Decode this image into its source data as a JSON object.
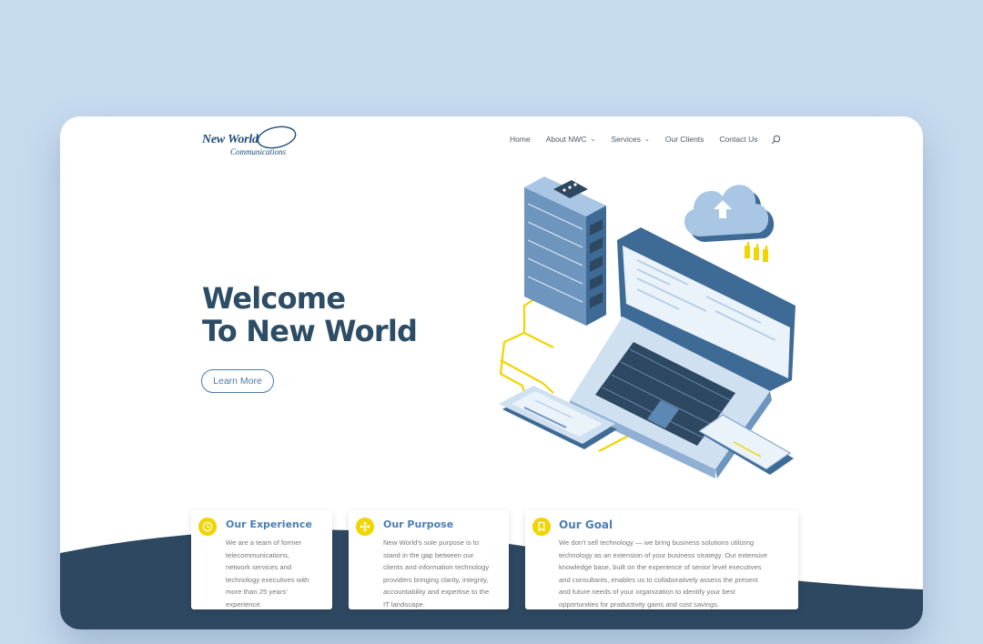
{
  "logo": {
    "line1": "New World",
    "line2": "Communications"
  },
  "nav": {
    "items": [
      {
        "label": "Home",
        "dropdown": false
      },
      {
        "label": "About NWC",
        "dropdown": true
      },
      {
        "label": "Services",
        "dropdown": true
      },
      {
        "label": "Our Clients",
        "dropdown": false
      },
      {
        "label": "Contact Us",
        "dropdown": false
      }
    ],
    "search_icon": "search-icon"
  },
  "hero": {
    "title_line1": "Welcome",
    "title_line2": "To New World",
    "cta_label": "Learn More"
  },
  "cards": [
    {
      "icon": "clock-icon",
      "title": "Our Experience",
      "lines": [
        "We are a team of former",
        "telecommunications,",
        "network services and",
        "technology executives with",
        "more than 25 years'",
        "experience."
      ]
    },
    {
      "icon": "move-arrows-icon",
      "title": "Our Purpose",
      "lines": [
        "New World's sole purpose is to",
        "stand in the gap between our",
        "clients and information technology",
        "providers bringing clarity, integrity,",
        "accountability and expertise to the",
        "IT landscape."
      ]
    },
    {
      "icon": "bookmark-icon",
      "title": "Our Goal",
      "lines": [
        "We don't sell technology — we bring business solutions utilizing",
        "technology as an extension of your business strategy. Our extensive",
        "knowledge base, built on the experience of senior level executives",
        "and consultants, enables us to collaboratively assess the present",
        "and future needs of your organization to identify your best",
        "opportunities for productivity gains and cost savings."
      ]
    }
  ],
  "colors": {
    "page_bg": "#c7dbef",
    "brand_navy": "#2d4d66",
    "accent_blue": "#4f7aa3",
    "accent_yellow": "#f0d500",
    "wave": "#2e4861"
  }
}
